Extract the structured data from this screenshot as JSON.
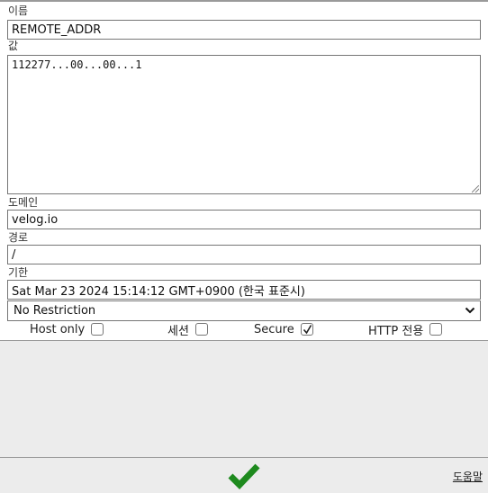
{
  "fields": {
    "name": {
      "label": "이름",
      "value": "REMOTE_ADDR"
    },
    "value": {
      "label": "값",
      "value": "112277...00...00...1"
    },
    "domain": {
      "label": "도메인",
      "value": "velog.io"
    },
    "path": {
      "label": "경로",
      "value": "/"
    },
    "expires": {
      "label": "기한",
      "value": "Sat Mar 23 2024 15:14:12 GMT+0900 (한국 표준시)"
    }
  },
  "samesite": {
    "selected": "No Restriction"
  },
  "options": {
    "host_only": {
      "label": "Host only",
      "checked": false
    },
    "session": {
      "label": "세션",
      "checked": false
    },
    "secure": {
      "label": "Secure",
      "checked": true
    },
    "http_only": {
      "label": "HTTP 전용",
      "checked": false
    }
  },
  "footer": {
    "help_label": "도움말",
    "confirm_icon": "checkmark-icon",
    "accent_color": "#1e8a1e"
  }
}
